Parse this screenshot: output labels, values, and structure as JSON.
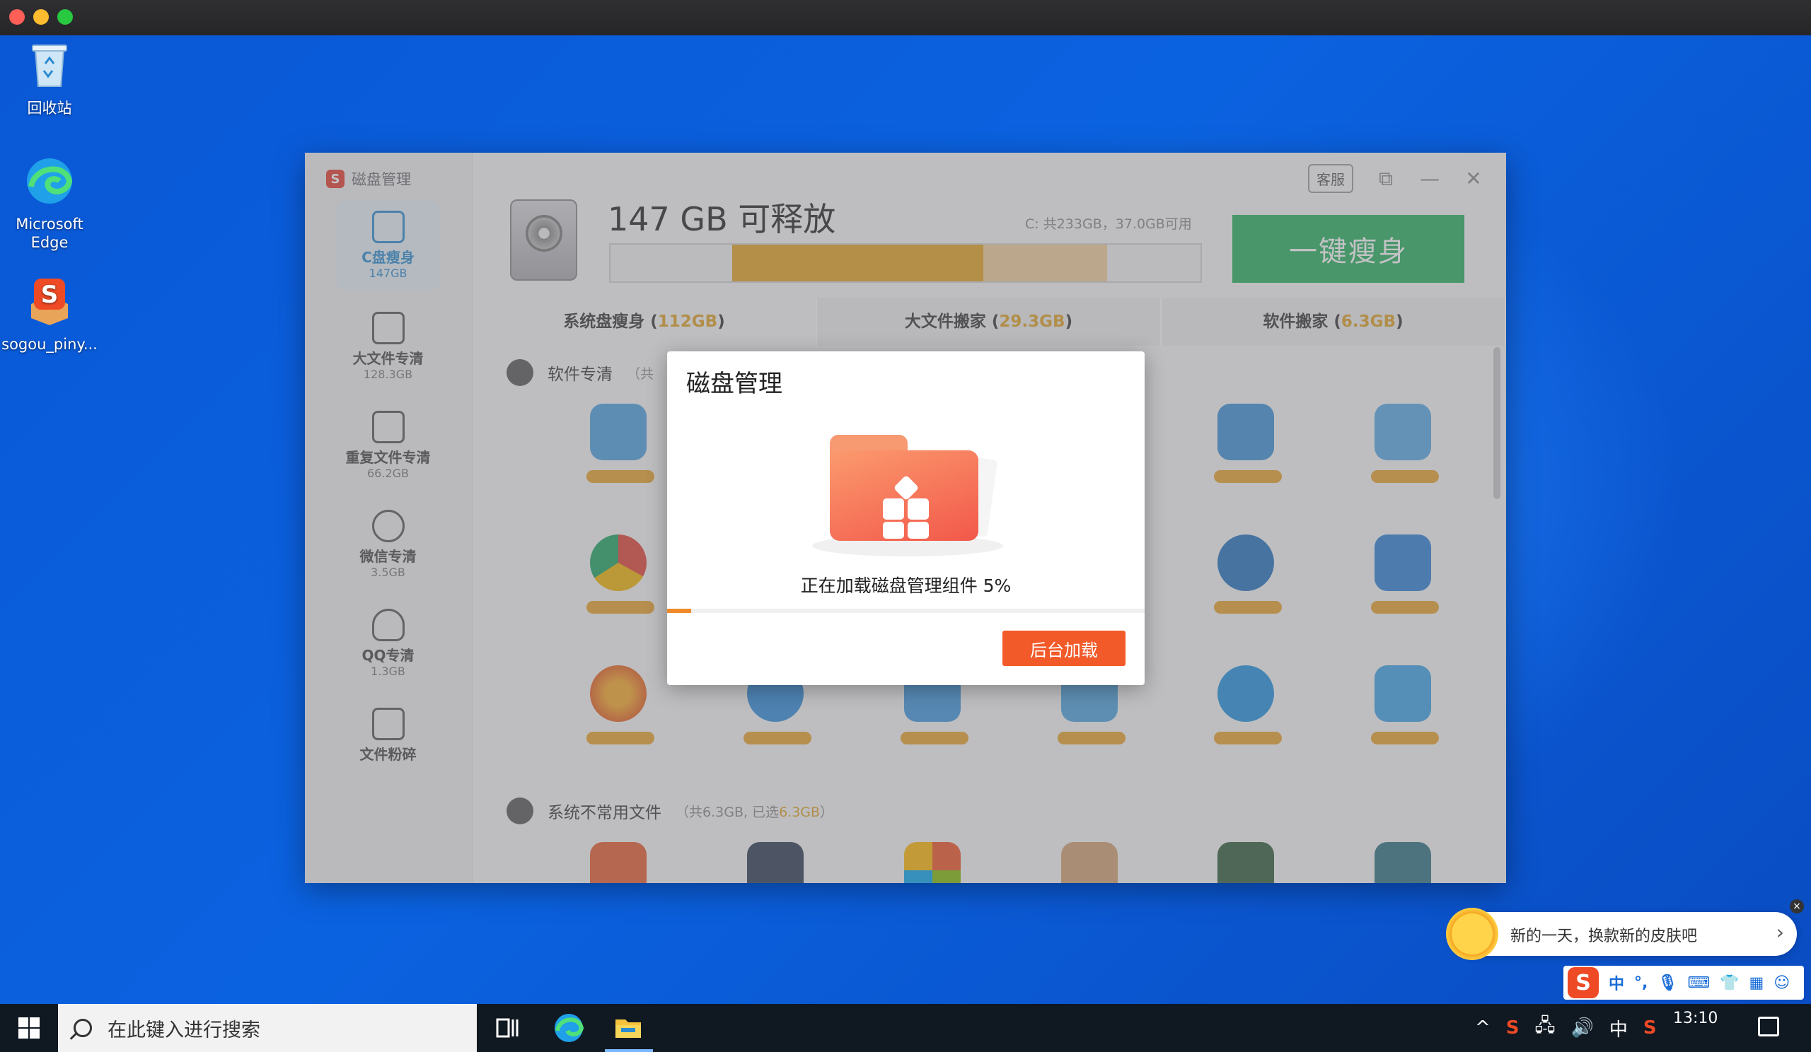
{
  "desktop": {
    "icons": [
      {
        "label": "回收站"
      },
      {
        "label": "Microsoft Edge"
      },
      {
        "label": "sogou_piny..."
      }
    ]
  },
  "app": {
    "title": "磁盘管理",
    "support_label": "客服",
    "free_title": "147 GB  可释放",
    "usage_text": "C: 共233GB，37.0GB可用",
    "one_key_label": "一键瘦身",
    "sidebar": [
      {
        "label": "C盘瘦身",
        "sub": "147GB"
      },
      {
        "label": "大文件专清",
        "sub": "128.3GB"
      },
      {
        "label": "重复文件专清",
        "sub": "66.2GB"
      },
      {
        "label": "微信专清",
        "sub": "3.5GB"
      },
      {
        "label": "QQ专清",
        "sub": "1.3GB"
      },
      {
        "label": "文件粉碎",
        "sub": ""
      }
    ],
    "tabs": [
      {
        "label": "系统盘瘦身",
        "amount": "112GB"
      },
      {
        "label": "大文件搬家",
        "amount": "29.3GB"
      },
      {
        "label": "软件搬家",
        "amount": "6.3GB"
      }
    ],
    "sections": [
      {
        "title": "软件专清",
        "note_prefix": "（共",
        "note": ""
      },
      {
        "title": "系统不常用文件",
        "note_prefix": "（共6.3GB, 已选",
        "note": "6.3GB",
        "note_suffix": "）"
      }
    ]
  },
  "dialog": {
    "title": "磁盘管理",
    "loading_text": "正在加载磁盘管理组件 5%",
    "progress_percent": 5,
    "background_button": "后台加载"
  },
  "sogou_tip": {
    "text": "新的一天，换款新的皮肤吧",
    "close": "×",
    "arrow": "›"
  },
  "ime": {
    "mode": "中",
    "punct": "°,"
  },
  "taskbar": {
    "search_placeholder": "在此键入进行搜索",
    "tray_lang": "中",
    "time": "13:10"
  },
  "colors": {
    "accent_green": "#21b05b",
    "accent_orange": "#f25a2a",
    "usage_used": "#e3a21c"
  }
}
